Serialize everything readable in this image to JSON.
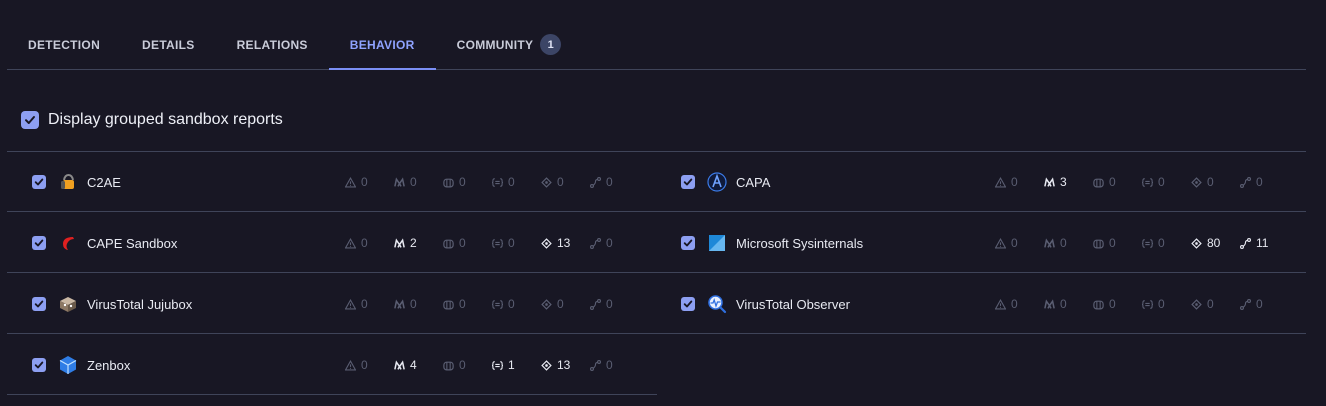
{
  "tabs": [
    {
      "label": "DETECTION"
    },
    {
      "label": "DETAILS"
    },
    {
      "label": "RELATIONS"
    },
    {
      "label": "BEHAVIOR",
      "active": true
    },
    {
      "label": "COMMUNITY",
      "badge": "1"
    }
  ],
  "group_toggle": {
    "label": "Display grouped sandbox reports",
    "checked": true
  },
  "sandboxes": [
    {
      "name": "C2AE",
      "icon": "c2ae-icon",
      "metrics": [
        "0",
        "0",
        "0",
        "0",
        "0",
        "0"
      ]
    },
    {
      "name": "CAPA",
      "icon": "capa-icon",
      "metrics": [
        "0",
        "3",
        "0",
        "0",
        "0",
        "0"
      ]
    },
    {
      "name": "CAPE Sandbox",
      "icon": "cape-icon",
      "metrics": [
        "0",
        "2",
        "0",
        "0",
        "13",
        "0"
      ]
    },
    {
      "name": "Microsoft Sysinternals",
      "icon": "sysinternals-icon",
      "metrics": [
        "0",
        "0",
        "0",
        "0",
        "80",
        "11"
      ]
    },
    {
      "name": "VirusTotal Jujubox",
      "icon": "jujubox-icon",
      "metrics": [
        "0",
        "0",
        "0",
        "0",
        "0",
        "0"
      ]
    },
    {
      "name": "VirusTotal Observer",
      "icon": "observer-icon",
      "metrics": [
        "0",
        "0",
        "0",
        "0",
        "0",
        "0"
      ]
    },
    {
      "name": "Zenbox",
      "icon": "zenbox-icon",
      "metrics": [
        "0",
        "4",
        "0",
        "1",
        "13",
        "0"
      ]
    }
  ],
  "metric_icons": [
    "warning-icon",
    "mitre-icon",
    "signature-icon",
    "ids-icon",
    "network-icon",
    "process-icon"
  ],
  "colors": {
    "accent": "#8fa3ff",
    "background": "#181724",
    "divider": "#3f4459"
  }
}
